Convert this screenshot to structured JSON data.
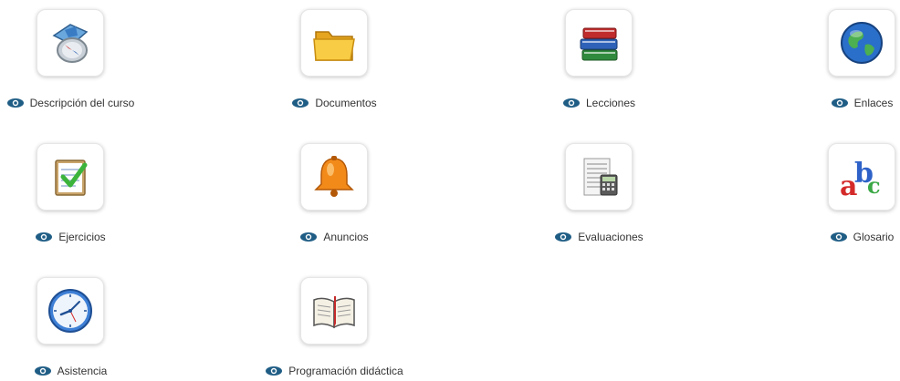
{
  "tools": [
    {
      "label": "Descripción del curso",
      "icon": "compass-map-icon"
    },
    {
      "label": "Documentos",
      "icon": "folder-icon"
    },
    {
      "label": "Lecciones",
      "icon": "books-icon"
    },
    {
      "label": "Enlaces",
      "icon": "globe-icon"
    },
    {
      "label": "Ejercicios",
      "icon": "checklist-icon"
    },
    {
      "label": "Anuncios",
      "icon": "bell-icon"
    },
    {
      "label": "Evaluaciones",
      "icon": "calculator-sheet-icon"
    },
    {
      "label": "Glosario",
      "icon": "abc-icon"
    },
    {
      "label": "Asistencia",
      "icon": "clock-icon"
    },
    {
      "label": "Programación didáctica",
      "icon": "open-book-icon"
    }
  ],
  "visibility_icon": "eye-icon"
}
